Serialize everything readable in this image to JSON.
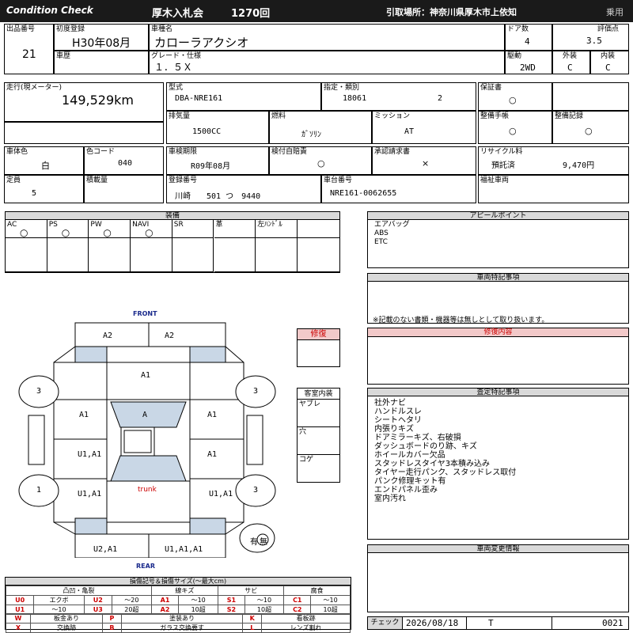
{
  "header": {
    "brand": "Condition  Check",
    "auction": "厚木入札会",
    "session": "1270回",
    "pickup": "引取場所：神奈川県厚木市上依知",
    "category": "乗用"
  },
  "top": {
    "lot_label": "出品番号",
    "lot": "21",
    "first_reg_label": "初度登録",
    "first_reg": "H30年08月",
    "history_label": "車歴",
    "model_label": "車種名",
    "model": "カローラアクシオ",
    "grade_label": "グレード・仕様",
    "grade": "１．５Ｘ",
    "doors_label": "ドア数",
    "doors": "4",
    "score_label": "評価点",
    "score": "3.5",
    "drive_label": "駆動",
    "drive": "2WD",
    "ext_label": "外装",
    "ext": "C",
    "int_label": "内装",
    "int": "C"
  },
  "spec": {
    "mileage_label": "走行(現メーター)",
    "mileage": "149,529km",
    "type_label": "型式",
    "type": "DBA-NRE161",
    "class_label": "指定・類別",
    "class_a": "18061",
    "class_b": "2",
    "disp_label": "排気量",
    "disp": "1500CC",
    "fuel_label": "燃料",
    "fuel": "ｶﾞｿﾘﾝ",
    "mission_label": "ミッション",
    "mission": "AT",
    "warranty_label": "保証書",
    "warranty": "○",
    "manual_label": "整備手帳",
    "manual": "○",
    "record_label": "整備記録",
    "record": "○",
    "color_label": "車体色",
    "color": "白",
    "colorcode_label": "色コード",
    "colorcode": "040",
    "inspection_label": "車検期限",
    "inspection": "R09年08月",
    "insurance_label": "検付自賠責",
    "insurance": "○",
    "approval_label": "承認請求書",
    "approval": "×",
    "recycle_label": "リサイクル料",
    "recycle_status": "預託済",
    "recycle_fee": "9,470円",
    "capacity_label": "定員",
    "capacity": "5",
    "load_label": "積載量",
    "regno_label": "登録番号",
    "regno": "川崎　　501 つ　9440",
    "chassis_label": "車台番号",
    "chassis": "NRE161-0062655",
    "welfare_label": "福祉車両"
  },
  "equipment": {
    "title": "装備",
    "items": [
      {
        "label": "AC",
        "mark": "○"
      },
      {
        "label": "PS",
        "mark": "○"
      },
      {
        "label": "PW",
        "mark": "○"
      },
      {
        "label": "NAVI",
        "mark": "○"
      },
      {
        "label": "SR",
        "mark": ""
      },
      {
        "label": "革",
        "mark": ""
      },
      {
        "label": "左ﾊﾝﾄﾞﾙ",
        "mark": ""
      }
    ]
  },
  "diagram": {
    "front": "FRONT",
    "rear": "REAR",
    "trunk": "trunk",
    "repair_label": "修復",
    "interior_label": "客室内装",
    "interior_items": [
      "ヤブレ",
      "穴",
      "コゲ"
    ],
    "marks": {
      "front_a": "A2",
      "front_b": "A2",
      "hood": "A1",
      "left_fender": "A1",
      "roof": "A",
      "right_fender": "A1",
      "left_front_door": "U1,A1",
      "right_front_door": "A1",
      "left_rear_door": "U1,A1",
      "right_rear_door": "U1,A1",
      "rear_a": "U2,A1",
      "rear_b": "U1,A1,A1",
      "wheel_lf": "3",
      "wheel_rf": "3",
      "wheel_lr": "1",
      "wheel_rr": "3",
      "spare_yes": "有",
      "spare_no": "無"
    }
  },
  "appeal": {
    "title": "アピールポイント",
    "lines": [
      "エアバッグ",
      "ABS",
      "ETC"
    ]
  },
  "special": {
    "title": "車両特記事項",
    "note": "※記載のない書類・機器等は無しとして取り扱います。"
  },
  "repair": {
    "title": "修復内容"
  },
  "assessment": {
    "title": "査定特記事項",
    "lines": [
      "社外ナビ",
      "ハンドルスレ",
      "シートヘタリ",
      "内張りキズ",
      "ドアミラーキズ、右破損",
      "ダッシュボードのり跡、キズ",
      "ホイールカバー欠品",
      "スタッドレスタイヤ3本積み込み",
      "タイヤー走行パンク、スタッドレス取付",
      "パンク修理キット有",
      "エンドパネル歪み",
      "室内汚れ"
    ]
  },
  "changes": {
    "title": "車両変更情報"
  },
  "check": {
    "label": "チェック",
    "date": "2026/08/18",
    "grade": "T",
    "code": "0021"
  },
  "legend": {
    "title": "損傷記号＆損傷サイズ(〜最大cm)",
    "h1": "凸凹・亀裂",
    "h2": "線キズ",
    "h3": "サビ",
    "h4": "腐食",
    "rows": [
      [
        "U0",
        "エクボ",
        "U2",
        "〜20",
        "A1",
        "〜10",
        "S1",
        "〜10",
        "C1",
        "〜10"
      ],
      [
        "U1",
        "〜10",
        "U3",
        "20超",
        "A2",
        "10超",
        "S2",
        "10超",
        "C2",
        "10超"
      ]
    ],
    "rows2": [
      [
        "W",
        "板金あり",
        "P",
        "塗装あり",
        "K",
        "看板跡"
      ],
      [
        "X",
        "交換跡",
        "B",
        "ガラス交換要す",
        "L",
        "レンズ割れ"
      ]
    ]
  }
}
